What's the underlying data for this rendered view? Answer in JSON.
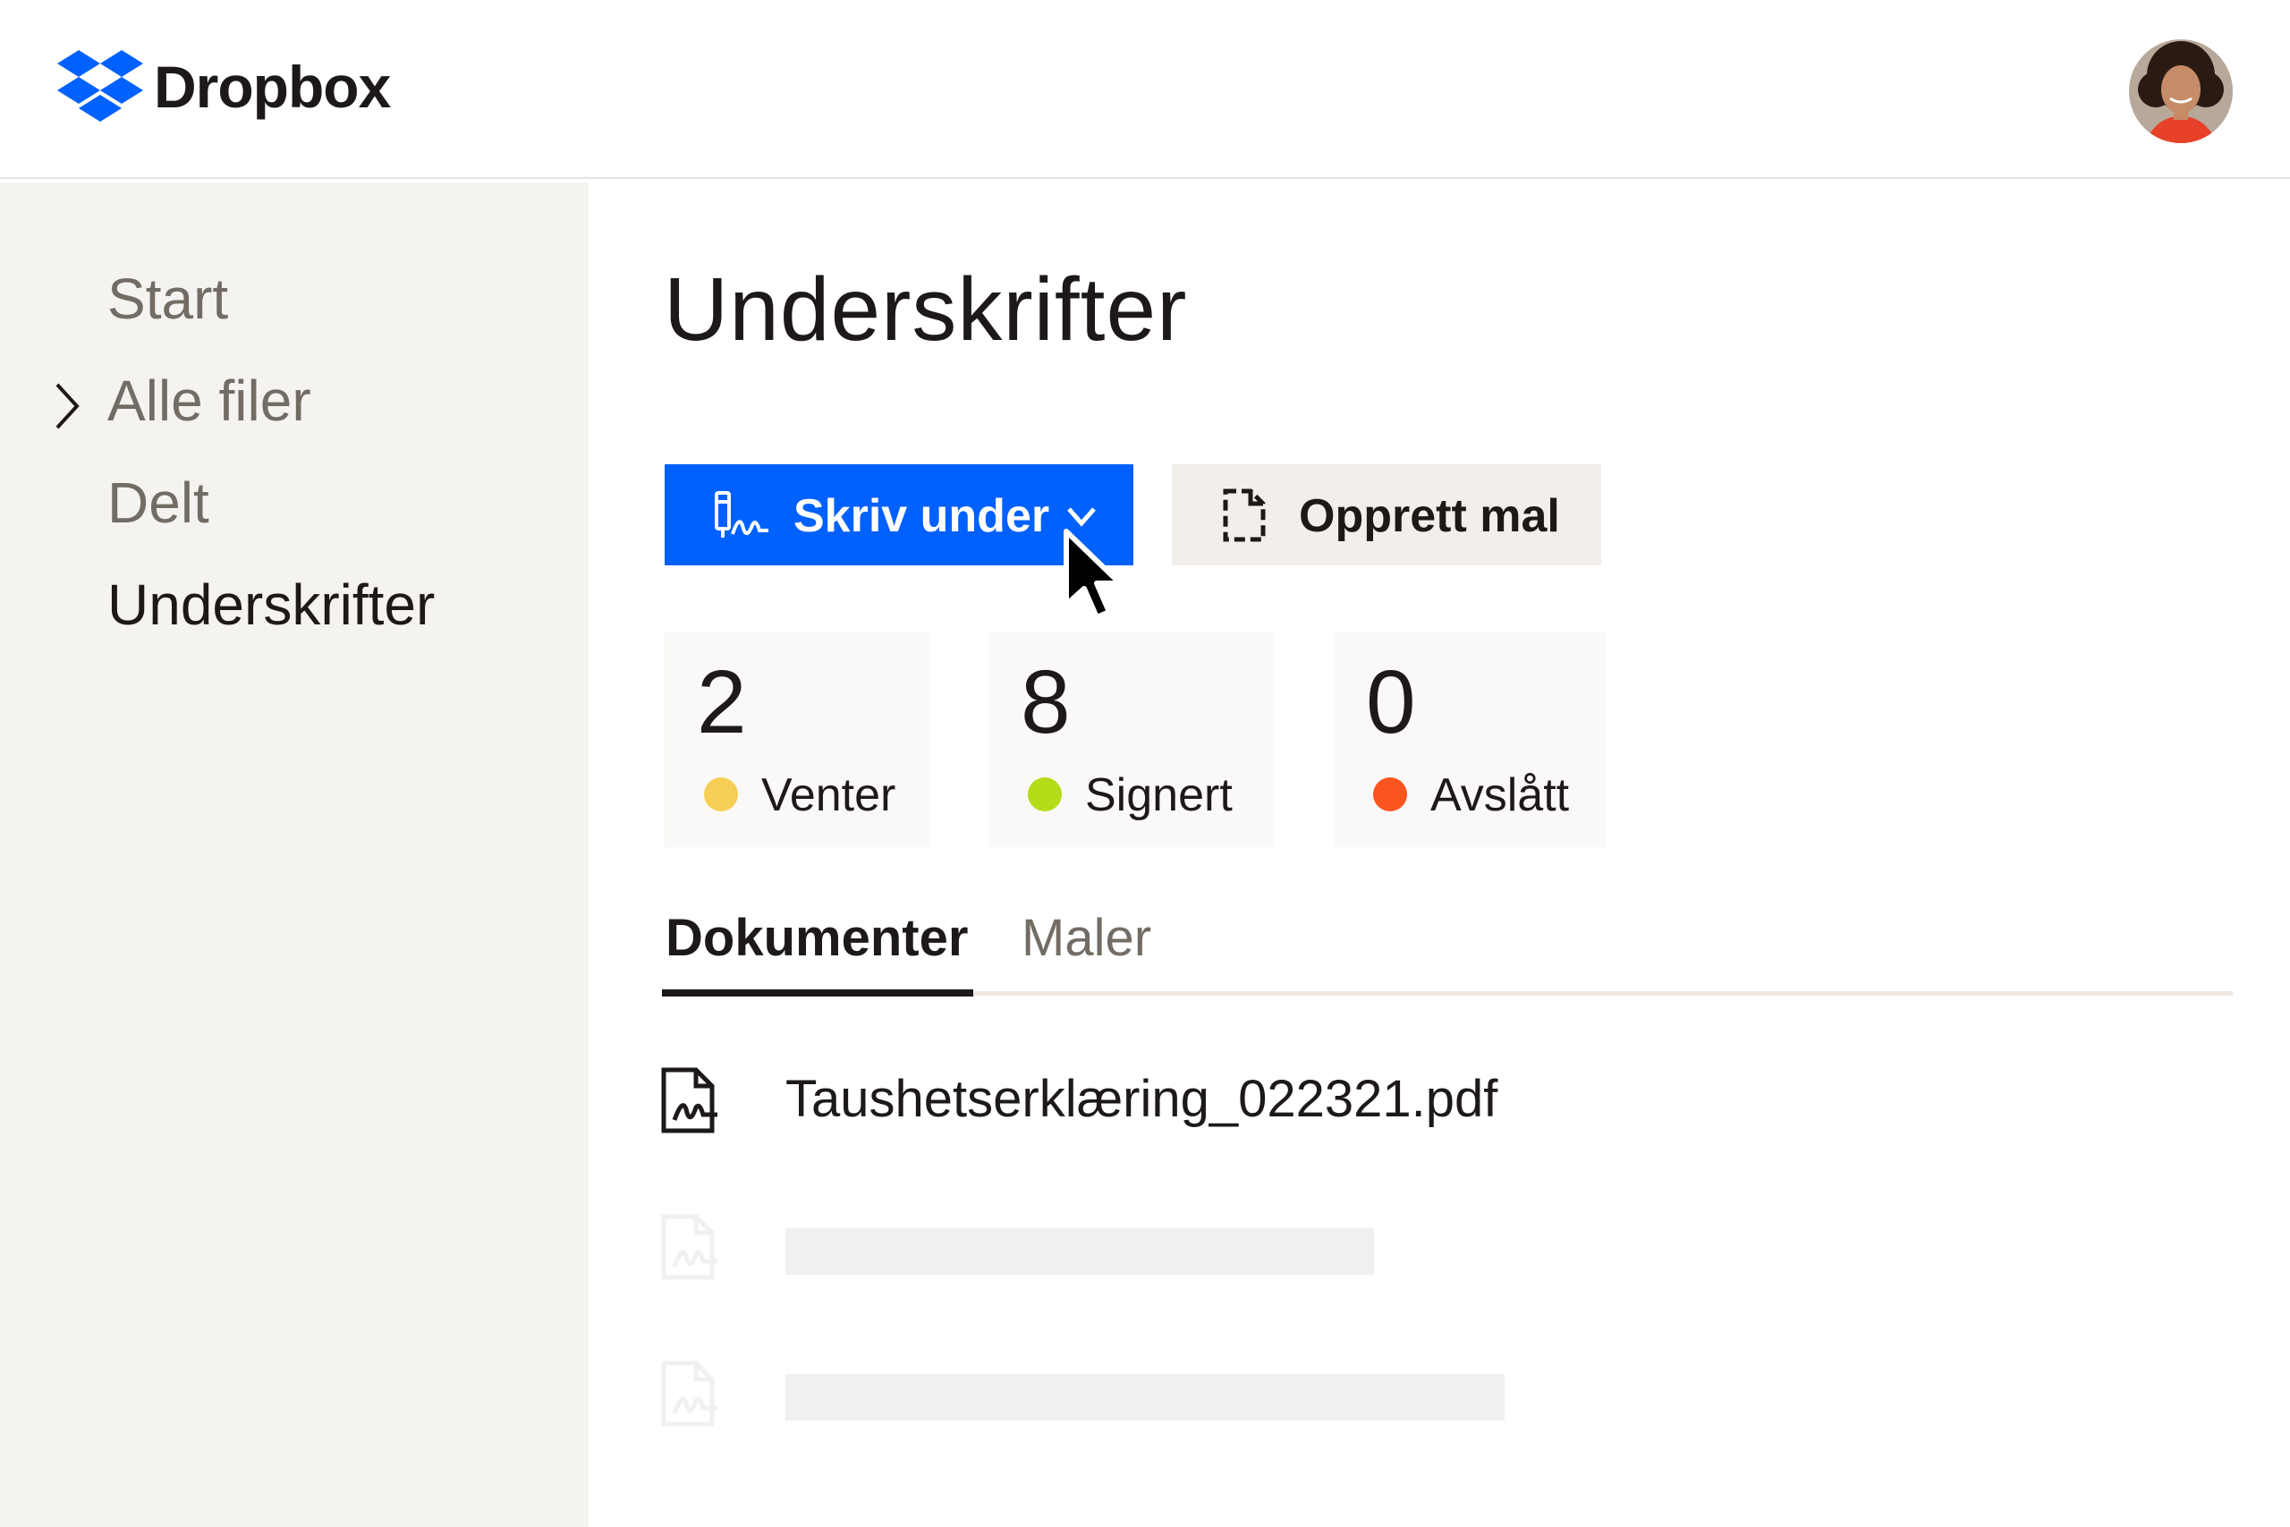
{
  "app": {
    "name": "Dropbox",
    "brand_color": "#0061fe"
  },
  "header": {
    "logo_text": "Dropbox",
    "avatar_icon": "user-avatar"
  },
  "sidebar": {
    "items": [
      {
        "label": "Start",
        "active": false,
        "expandable": false
      },
      {
        "label": "Alle filer",
        "active": false,
        "expandable": true
      },
      {
        "label": "Delt",
        "active": false,
        "expandable": false
      },
      {
        "label": "Underskrifter",
        "active": true,
        "expandable": false
      }
    ]
  },
  "main": {
    "title": "Underskrifter",
    "actions": {
      "sign_label": "Skriv under",
      "sign_icon": "signature-pen-icon",
      "template_label": "Opprett mal",
      "template_icon": "document-dashed-icon"
    },
    "stats": [
      {
        "count": "2",
        "label": "Venter",
        "color": "#f7ce55"
      },
      {
        "count": "8",
        "label": "Signert",
        "color": "#b4dc19"
      },
      {
        "count": "0",
        "label": "Avslått",
        "color": "#fa551e"
      }
    ],
    "tabs": [
      {
        "label": "Dokumenter",
        "active": true
      },
      {
        "label": "Maler",
        "active": false
      }
    ],
    "documents": [
      {
        "name": "Taushetserklæring_022321.pdf",
        "icon": "signed-document-icon"
      }
    ]
  }
}
